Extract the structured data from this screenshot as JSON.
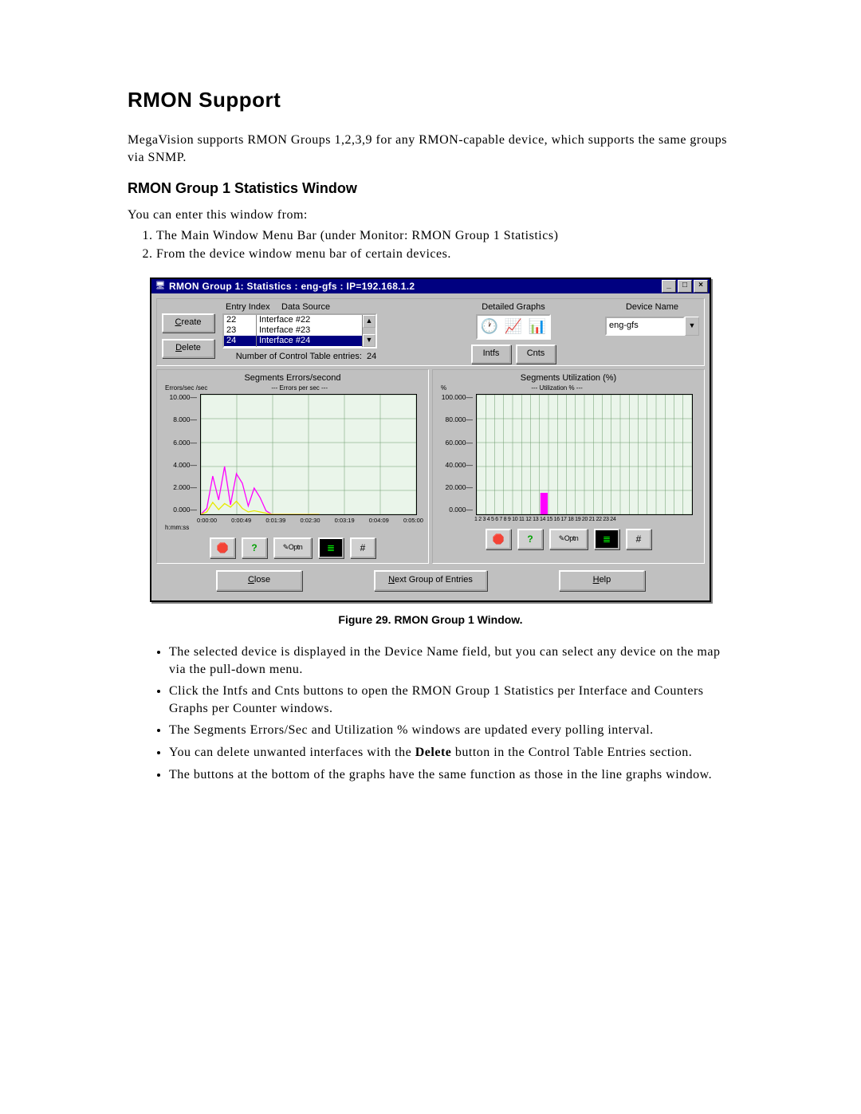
{
  "doc": {
    "title": "RMON Support",
    "intro": "MegaVision supports RMON Groups 1,2,3,9 for any RMON-capable device, which supports the same groups via SNMP.",
    "subtitle": "RMON Group 1 Statistics Window",
    "lead": "You can enter this window from:",
    "steps": [
      "The Main Window Menu Bar (under Monitor: RMON Group 1 Statistics)",
      "From the device window menu bar of certain devices."
    ],
    "figcaption": "Figure 29. RMON Group 1 Window.",
    "bullets": [
      "The selected device is displayed in the Device Name field, but you can select any device on the map via the pull-down menu.",
      "Click the Intfs and Cnts buttons to open the RMON Group 1 Statistics per Interface and Counters Graphs per Counter windows.",
      "The Segments Errors/Sec and Utilization % windows are updated every polling interval.",
      "You can delete unwanted interfaces with the Delete button in the Control Table Entries section.",
      "The buttons at the bottom of the graphs have the same function as those in the line graphs window."
    ]
  },
  "win": {
    "title": "RMON Group 1: Statistics : eng-gfs : IP=192.168.1.2",
    "entry_index_label": "Entry Index",
    "data_source_label": "Data Source",
    "create": "Create",
    "delete": "Delete",
    "count_label": "Number of Control Table entries:",
    "count_value": "24",
    "detailed_graphs": "Detailed Graphs",
    "intfs": "Intfs",
    "cnts": "Cnts",
    "device_name_label": "Device Name",
    "device_name": "eng-gfs",
    "close": "Close",
    "next": "Next Group of Entries",
    "help": "Help",
    "rows": [
      {
        "idx": "22",
        "ds": "Interface  #22"
      },
      {
        "idx": "23",
        "ds": "Interface  #23"
      },
      {
        "idx": "24",
        "ds": "Interface  #24"
      }
    ]
  },
  "chart_data": [
    {
      "type": "line",
      "title": "Segments Errors/second",
      "ylabel": "Errors/sec /sec",
      "axistitle": "--- Errors per sec ---",
      "ylim": [
        0,
        10
      ],
      "yticks": [
        "10.000",
        "8.000",
        "6.000",
        "4.000",
        "2.000",
        "0.000"
      ],
      "x_label": "h:mm:ss",
      "xticks": [
        "0:00:00",
        "0:00:49",
        "0:01:39",
        "0:02:30",
        "0:03:19",
        "0:04:09",
        "0:05:00"
      ],
      "series": [
        {
          "name": "magenta",
          "color": "#ff00ff",
          "values": [
            0,
            0.5,
            3.2,
            1.2,
            4.0,
            0.8,
            3.4,
            2.6,
            0.7,
            2.2,
            1.4,
            0.3,
            0,
            0,
            0,
            0,
            0,
            0,
            0,
            0,
            0
          ]
        },
        {
          "name": "yellow",
          "color": "#e8e800",
          "values": [
            0,
            0.2,
            1.0,
            0.4,
            0.9,
            0.6,
            1.1,
            0.5,
            0.2,
            0.3,
            0.2,
            0.1,
            0,
            0,
            0,
            0,
            0,
            0,
            0,
            0,
            0
          ]
        }
      ]
    },
    {
      "type": "bar",
      "title": "Segments Utilization (%)",
      "ylabel": "%",
      "axistitle": "--- Utilization % ---",
      "ylim": [
        0,
        100
      ],
      "yticks": [
        "100.000",
        "80.000",
        "60.000",
        "40.000",
        "20.000",
        "0.000"
      ],
      "categories": [
        "1",
        "2",
        "3",
        "4",
        "5",
        "6",
        "7",
        "8",
        "9",
        "10",
        "11",
        "12",
        "13",
        "14",
        "15",
        "16",
        "17",
        "18",
        "19",
        "20",
        "21",
        "22",
        "23",
        "24"
      ],
      "series": [
        {
          "name": "util",
          "color": "#ff00ff",
          "values": [
            0,
            0,
            0,
            0,
            0,
            0,
            0,
            18,
            0,
            0,
            0,
            0,
            0,
            0,
            0,
            0,
            0,
            0,
            0,
            0,
            0,
            0,
            0,
            0
          ]
        }
      ]
    }
  ],
  "toolbar_icons": [
    "🛑",
    "?",
    "✎Optn",
    "≣",
    "#"
  ]
}
